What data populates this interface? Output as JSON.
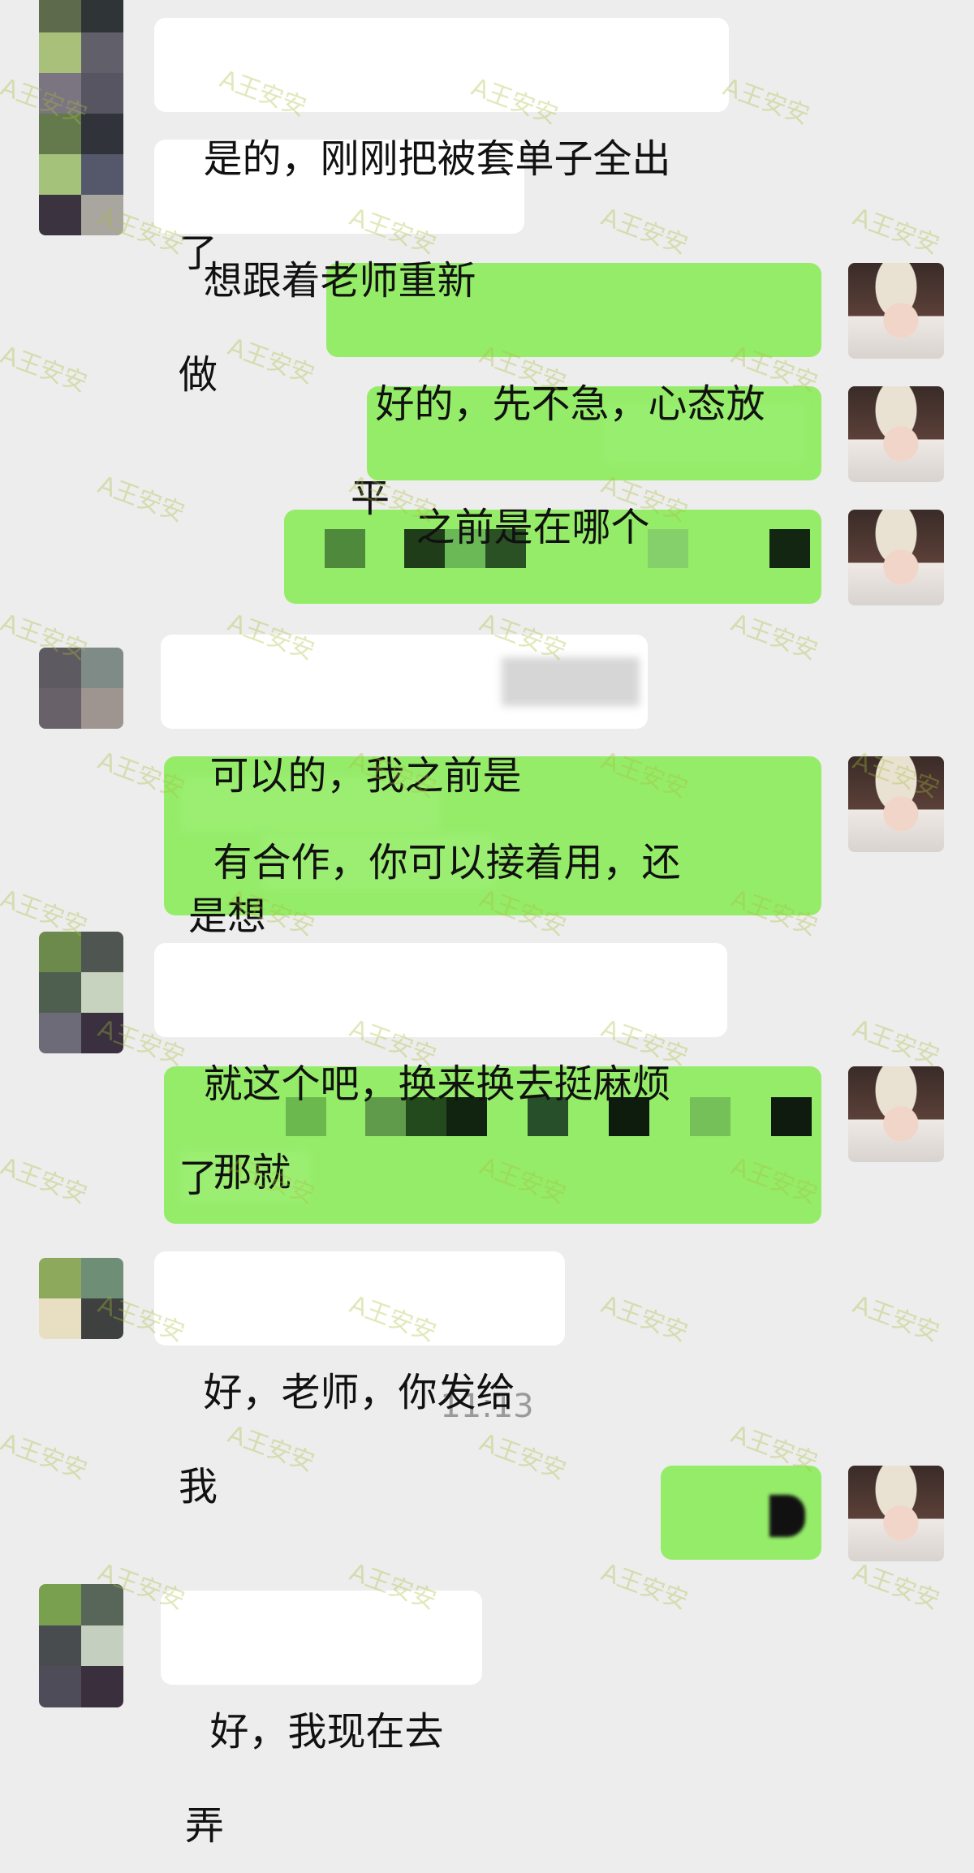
{
  "timestamp": "11:13",
  "watermark": "A王安安",
  "messages": [
    {
      "side": "in",
      "text": "是的，刚刚把被套单子全出了"
    },
    {
      "side": "in",
      "text": "想跟着老师重新做"
    },
    {
      "side": "out",
      "text": "好的，先不急，心态放平"
    },
    {
      "side": "out",
      "text": "之前是在哪个"
    },
    {
      "side": "out",
      "text": ""
    },
    {
      "side": "in",
      "text": "可以的，我之前是"
    },
    {
      "side": "out",
      "text": "有合作，你可以接着用，还\n是想"
    },
    {
      "side": "in",
      "text": "就这个吧，换来换去挺麻烦了"
    },
    {
      "side": "out",
      "text": "那就"
    },
    {
      "side": "in",
      "text": "好，老师，你发给我"
    },
    {
      "side": "out",
      "text": ""
    },
    {
      "side": "in",
      "text": "好，我现在去弄"
    }
  ],
  "colors": {
    "bg": "#ededed",
    "incoming": "#ffffff",
    "outgoing": "#95ec69",
    "time": "#9a9a9a"
  }
}
